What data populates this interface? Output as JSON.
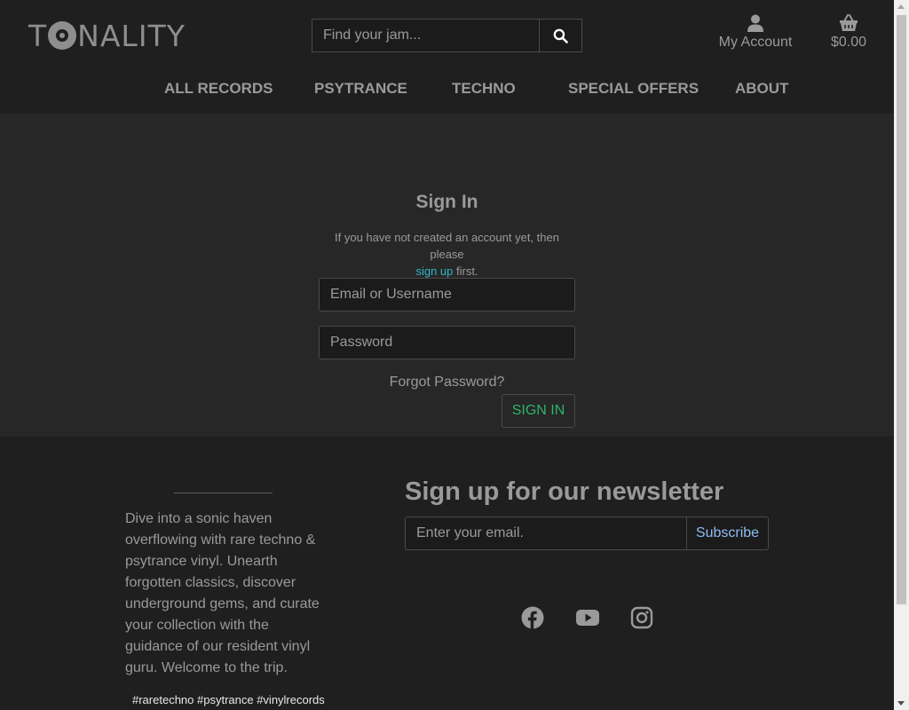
{
  "header": {
    "logo_before": "T",
    "logo_after": "NALITY",
    "search": {
      "placeholder": "Find your jam...",
      "value": "",
      "button_icon": "search-icon"
    },
    "account": {
      "label": "My Account",
      "icon": "user-icon"
    },
    "cart": {
      "total": "$0.00",
      "icon": "basket-icon"
    }
  },
  "nav": {
    "items": [
      {
        "label": "ALL RECORDS"
      },
      {
        "label": "PSYTRANCE"
      },
      {
        "label": "TECHNO"
      },
      {
        "label": "SPECIAL OFFERS"
      },
      {
        "label": "ABOUT"
      }
    ]
  },
  "signin": {
    "title": "Sign In",
    "note_before": "If you have not created an account yet, then please ",
    "note_link": "sign up",
    "note_after": " first.",
    "email_placeholder": "Email or Username",
    "password_placeholder": "Password",
    "forgot_label": "Forgot Password?",
    "submit_label": "SIGN IN"
  },
  "footer": {
    "about_text": "Dive into a sonic haven overflowing with rare techno & psytrance vinyl. Unearth forgotten classics, discover underground gems, and curate your collection with the guidance of our resident vinyl guru. Welcome to the trip.",
    "tags": "#raretechno #psytrance #vinylrecords",
    "newsletter_title": "Sign up for our newsletter",
    "newsletter_placeholder": "Enter your email.",
    "subscribe_label": "Subscribe",
    "social_icons": [
      "facebook-icon",
      "youtube-icon",
      "instagram-icon"
    ]
  },
  "colors": {
    "background": "#1e1f1e",
    "panel": "#262726",
    "text": "#9a9a9a",
    "link": "#35b6c9",
    "signin_button": "#2fb36a",
    "subscribe_button": "#8fbdf2"
  }
}
